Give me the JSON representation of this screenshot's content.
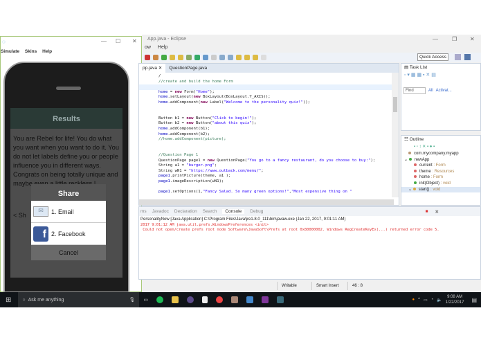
{
  "eclipse": {
    "title": "App.java - Eclipse",
    "menu": [
      "ow",
      "Help"
    ],
    "quick_access": "Quick Access",
    "editor_tabs": [
      "pp.java",
      "QuestionPage.java"
    ],
    "code": [
      "/",
      "//create and build the home Form",
      "",
      "home = new Form(\"Home\");",
      "home.setLayout(new BoxLayout(BoxLayout.Y_AXIS));",
      "home.addComponent(new Label(\"Welcome to the personality quiz!\"));",
      "",
      "",
      "Button b1 = new Button(\"Click to begin!\");",
      "Button b2 = new Button(\"about this quiz\");",
      "home.addComponent(b1);",
      "home.addComponent(b2);",
      "//home.addComponent(picture);",
      "",
      "",
      "//Question Page 1",
      "QuestionPage page1 = new QuestionPage(\"You go to a fancy restaurant, do you choose to buy:\");",
      "String a1 = \"burger.png\";",
      "String wN1 = \"https://www.outback.com/menu/\";",
      "page1.printPicture(theme, a1 );",
      "page1.imageDescription(wN1);",
      "",
      "page1.setOptions(1,\"Fancy Salad. So many green options!\",\"Most expensive thing on \""
    ],
    "tasklist": {
      "title": "Task List",
      "find": "Find",
      "all": "All",
      "activate": "Activat..."
    },
    "outline": {
      "title": "Outline",
      "items": [
        {
          "label": "com.mycompany.myapp",
          "type": ""
        },
        {
          "label": "newApp",
          "type": ""
        },
        {
          "label": "current",
          "type": " : Form"
        },
        {
          "label": "theme",
          "type": " : Resources"
        },
        {
          "label": "home",
          "type": " : Form"
        },
        {
          "label": "init(Object)",
          "type": " : void"
        },
        {
          "label": "start()",
          "type": " : void"
        }
      ]
    },
    "console": {
      "tabs": [
        "ms",
        "Javadoc",
        "Declaration",
        "Search",
        "Console",
        "Debug"
      ],
      "header": "PersonalityNow [Java Application] C:\\Program Files\\Java\\jre1.8.0_111\\bin\\javaw.exe (Jan 22, 2017, 9:01:11 AM)",
      "lines": [
        "2017 9:01:12 AM java.util.prefs.WindowsPreferences <init>",
        " Could not open/create prefs root node Software\\JavaSoft\\Prefs at root 0x80000002. Windows RegCreateKeyEx(...) returned error code 5."
      ]
    },
    "status": [
      "Writable",
      "Smart Insert",
      "46 : 8"
    ]
  },
  "simulator": {
    "menu": [
      "Simulate",
      "Skins",
      "Help"
    ],
    "screen_title": "Results",
    "result_text": "You are Rebel for life! You do what you want when you want to do it. You do not let labels define you or people influence you in different ways. Congrats on being totally unique and maybe even a little reckless !",
    "share_label": "Sh",
    "dialog": {
      "title": "Share",
      "items": [
        "1. Email",
        "2. Facebook"
      ],
      "cancel": "Cancel"
    }
  },
  "taskbar": {
    "search": "Ask me anything",
    "time": "9:08 AM",
    "date": "1/22/2017"
  }
}
